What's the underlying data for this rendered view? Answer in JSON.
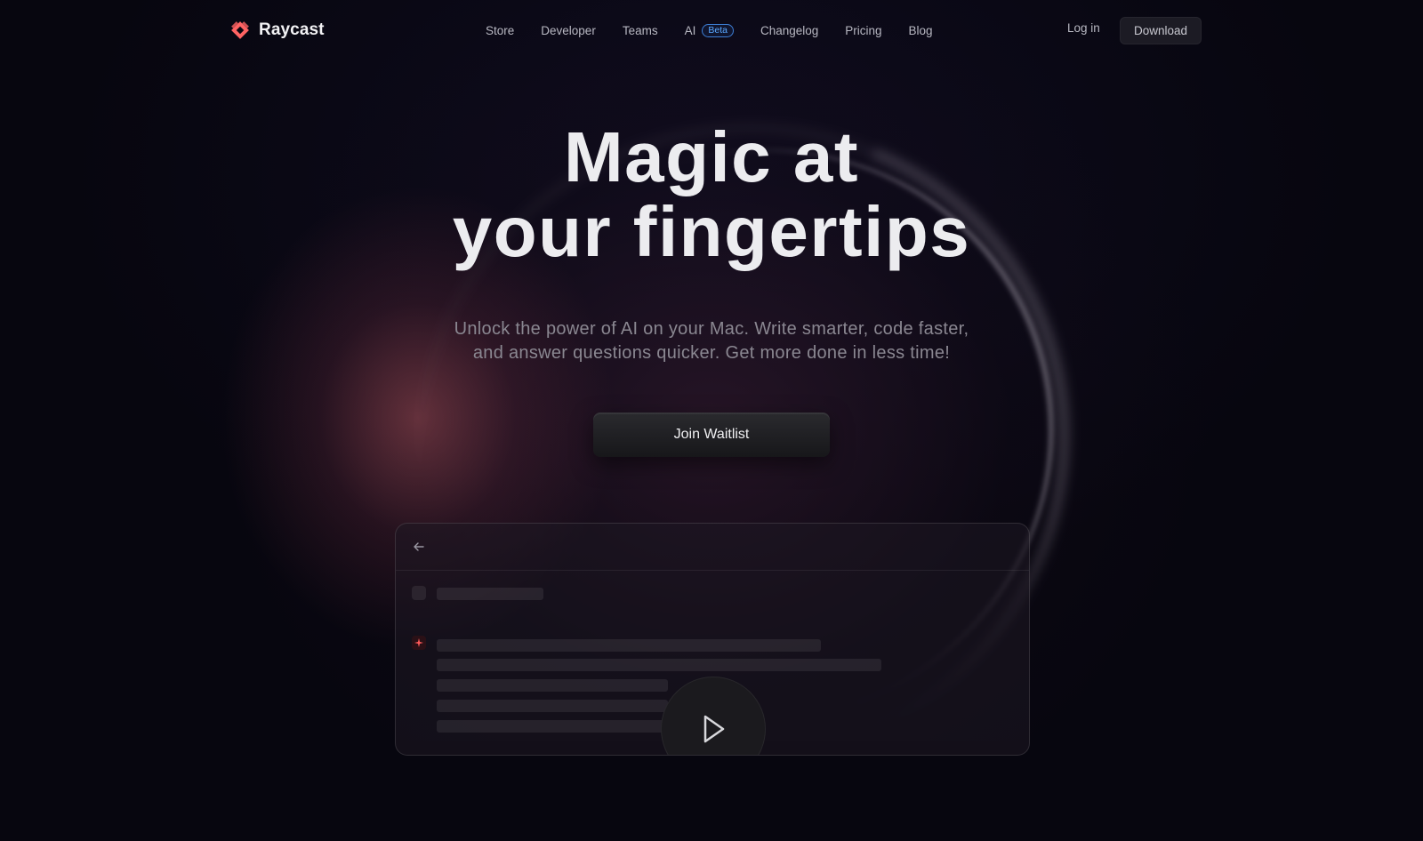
{
  "nav": {
    "brand": "Raycast",
    "links": [
      {
        "label": "Store"
      },
      {
        "label": "Developer"
      },
      {
        "label": "Teams"
      },
      {
        "label": "AI",
        "badge": "Beta"
      },
      {
        "label": "Changelog"
      },
      {
        "label": "Pricing"
      },
      {
        "label": "Blog"
      }
    ],
    "login": "Log in",
    "download": "Download"
  },
  "hero": {
    "title_line1": "Magic at",
    "title_line2": "your fingertips",
    "subtitle_line1": "Unlock the power of AI on your Mac. Write smarter, code faster,",
    "subtitle_line2": "and answer questions quicker. Get more done in less time!",
    "cta": "Join Waitlist"
  },
  "colors": {
    "background": "#07060f",
    "brand_red": "#ff6363",
    "beta_blue": "#5aa8ff"
  },
  "icons": {
    "logo": "raycast-logo-icon",
    "back": "arrow-left-icon",
    "play": "play-icon"
  }
}
